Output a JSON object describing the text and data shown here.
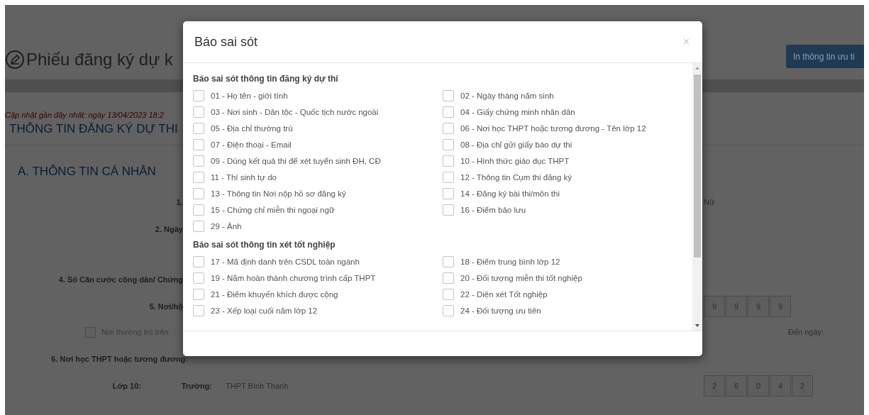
{
  "page": {
    "title": "Phiếu đăng ký dự k",
    "print_button": "In thông tin ưu ti",
    "updated_note": "Cập nhật gần đây nhất: ngày 13/04/2023 18:2",
    "section_title": "THÔNG TIN ĐĂNG KÝ DỰ THI",
    "subsection_title": "A. THÔNG TIN CÁ NHÂN",
    "row_1": {
      "label": "1.",
      "value": "Nữ"
    },
    "row_2": {
      "label": "2. Ngày"
    },
    "row_4": {
      "label": "4. Số Căn cước công dân/ Chứng"
    },
    "row_5": {
      "label": "5. Nơi/hộ",
      "digits": [
        "9",
        "9",
        "9",
        "9"
      ]
    },
    "residence": {
      "checkbox_label": "Nơi thường trú trên",
      "checked": false,
      "to_date_label": "Đến ngày:"
    },
    "school_heading": "6. Nơi học THPT hoặc tương đương:",
    "grade_10": {
      "label": "Lớp 10:",
      "school_label": "Trường:",
      "school": "THPT Bình Thanh",
      "digits": [
        "2",
        "6",
        "0",
        "4",
        "2"
      ]
    }
  },
  "modal": {
    "title": "Báo sai sót",
    "close": "×",
    "sections": [
      {
        "heading": "Báo sai sót thông tin đăng ký dự thi",
        "items": [
          {
            "label": "01 - Họ tên - giới tính",
            "checked": false
          },
          {
            "label": "02 - Ngày tháng năm sinh",
            "checked": false
          },
          {
            "label": "03 - Nơi sinh - Dân tộc - Quốc tịch nước ngoài",
            "checked": false
          },
          {
            "label": "04 - Giấy chứng minh nhân dân",
            "checked": false
          },
          {
            "label": "05 - Địa chỉ thường trú",
            "checked": false
          },
          {
            "label": "06 - Nơi học THPT hoặc tương đương - Tên lớp 12",
            "checked": false
          },
          {
            "label": "07 - Điện thoại - Email",
            "checked": false
          },
          {
            "label": "08 - Địa chỉ gửi giấy báo dự thi",
            "checked": false
          },
          {
            "label": "09 - Dùng kết quả thi để xét tuyển sinh ĐH, CĐ",
            "checked": false
          },
          {
            "label": "10 - Hình thức giáo dục THPT",
            "checked": false
          },
          {
            "label": "11 - Thí sinh tự do",
            "checked": false
          },
          {
            "label": "12 - Thông tin Cụm thi đăng ký",
            "checked": false
          },
          {
            "label": "13 - Thông tin Nơi nộp hồ sơ đăng ký",
            "checked": false
          },
          {
            "label": "14 - Đăng ký bài thi/môn thi",
            "checked": false
          },
          {
            "label": "15 - Chứng chỉ miễn thi ngoại ngữ",
            "checked": false
          },
          {
            "label": "16 - Điểm bảo lưu",
            "checked": false
          },
          {
            "label": "29 - Ảnh",
            "checked": false
          }
        ]
      },
      {
        "heading": "Báo sai sót thông tin xét tốt nghiệp",
        "items": [
          {
            "label": "17 - Mã định danh trên CSDL toàn ngành",
            "checked": false
          },
          {
            "label": "18 - Điểm trung bình lớp 12",
            "checked": false
          },
          {
            "label": "19 - Năm hoàn thành chương trình cấp THPT",
            "checked": false
          },
          {
            "label": "20 - Đối tượng miễn thi tốt nghiệp",
            "checked": false
          },
          {
            "label": "21 - Điểm khuyến khích được cộng",
            "checked": false
          },
          {
            "label": "22 - Diện xét Tốt nghiệp",
            "checked": false
          },
          {
            "label": "23 - Xếp loại cuối năm lớp 12",
            "checked": false
          },
          {
            "label": "24 - Đối tượng ưu tiên",
            "checked": false
          }
        ]
      }
    ]
  }
}
